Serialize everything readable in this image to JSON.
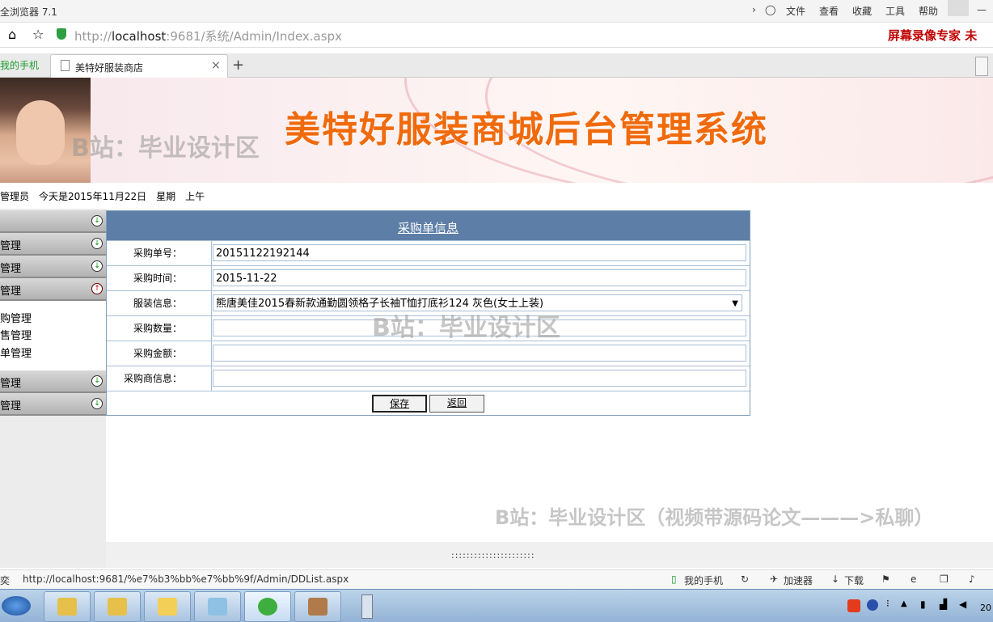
{
  "browser": {
    "title": "全浏览器 7.1",
    "menu": [
      "文件",
      "查看",
      "收藏",
      "工具",
      "帮助"
    ],
    "url_prefix": "http://",
    "url_host": "localhost",
    "url_rest": ":9681/系统/Admin/Index.aspx",
    "recorder_text": "屏幕录像专家  未",
    "tabs": [
      "我的手机",
      "美特好服装商店"
    ],
    "new_tab": "+",
    "close_tab": "×"
  },
  "banner": {
    "title": "美特好服装商城后台管理系统",
    "watermark": "B站：毕业设计区"
  },
  "info": {
    "role": "管理员",
    "date": "今天是2015年11月22日",
    "weekday": "星期",
    "period": "上午"
  },
  "sidebar": {
    "items": [
      {
        "label": ""
      },
      {
        "label": "管理"
      },
      {
        "label": "管理"
      },
      {
        "label": "管理"
      },
      {
        "label": "管理"
      },
      {
        "label": "管理"
      }
    ],
    "subitems": [
      "购管理",
      "售管理",
      "单管理"
    ]
  },
  "form": {
    "title": "采购单信息",
    "fields": [
      {
        "label": "采购单号：",
        "value": "20151122192144"
      },
      {
        "label": "采购时间：",
        "value": "2015-11-22"
      },
      {
        "label": "服装信息：",
        "value": "熊唐美佳2015春新款通勤圆领格子长袖T恤打底衫124 灰色(女士上装)"
      },
      {
        "label": "采购数量：",
        "value": ""
      },
      {
        "label": "采购金额：",
        "value": ""
      },
      {
        "label": "采购商信息：",
        "value": ""
      }
    ],
    "save_label": "保存",
    "back_label": "返回"
  },
  "watermarks": {
    "middle": "B站：毕业设计区",
    "bottom": "B站：毕业设计区（视频带源码论文———>私聊）"
  },
  "splitter": "::::::::::::::::::::::",
  "statusbar": {
    "left": "奕",
    "url": "http://localhost:9681/%e7%b3%bb%e7%bb%9f/Admin/DDList.aspx",
    "items": [
      "我的手机",
      "加速器",
      "下载"
    ]
  },
  "taskbar": {
    "clock": "20"
  }
}
